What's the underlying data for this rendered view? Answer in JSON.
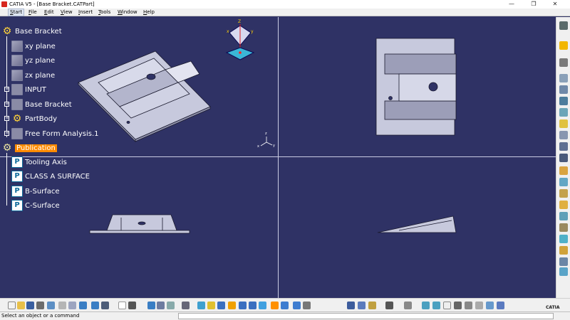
{
  "window": {
    "title": "CATIA V5 - [Base Bracket.CATPart]",
    "buttons": {
      "minimize": "—",
      "restore": "❐",
      "close": "✕"
    }
  },
  "menu": {
    "items": [
      {
        "pre": "",
        "mn": "S",
        "post": "tart"
      },
      {
        "pre": "",
        "mn": "F",
        "post": "ile"
      },
      {
        "pre": "",
        "mn": "E",
        "post": "dit"
      },
      {
        "pre": "",
        "mn": "V",
        "post": "iew"
      },
      {
        "pre": "",
        "mn": "I",
        "post": "nsert"
      },
      {
        "pre": "",
        "mn": "T",
        "post": "ools"
      },
      {
        "pre": "",
        "mn": "W",
        "post": "indow"
      },
      {
        "pre": "",
        "mn": "H",
        "post": "elp"
      }
    ]
  },
  "tree": {
    "root": "Base Bracket",
    "nodes": [
      {
        "label": "xy plane",
        "icon": "plane-icon"
      },
      {
        "label": "yz plane",
        "icon": "plane-icon"
      },
      {
        "label": "zx plane",
        "icon": "plane-icon"
      },
      {
        "label": "INPUT",
        "icon": "geometrical-set-icon"
      },
      {
        "label": "Base Bracket",
        "icon": "geometrical-set-icon"
      },
      {
        "label": "PartBody",
        "icon": "body-gear-icon"
      },
      {
        "label": "Free Form Analysis.1",
        "icon": "analysis-icon"
      }
    ],
    "publication": "Publication",
    "publications": [
      "Tooling Axis",
      "CLASS A SURFACE",
      "B-Surface",
      "C-Surface"
    ]
  },
  "compass": {
    "z_label": "Z",
    "x_label": "x",
    "y_label": "y"
  },
  "axis_triad": {
    "x_label": "x",
    "y_label": "y",
    "z_label": "z"
  },
  "status": {
    "prompt": "Select an object or a command",
    "logo": "CATIA"
  },
  "colors": {
    "background": "#2f3265",
    "selection": "#ff8a00",
    "part": "#c7c9dd",
    "part_edge": "#1a1a2e"
  }
}
